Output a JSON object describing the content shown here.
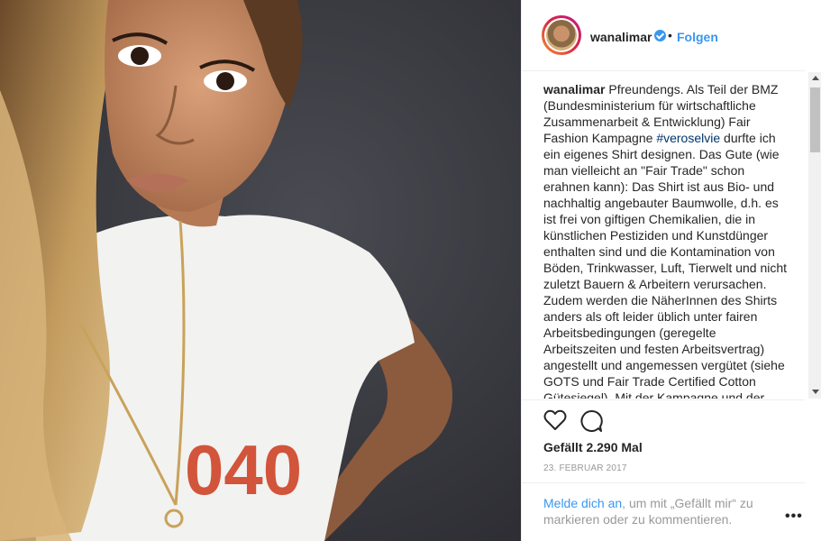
{
  "post": {
    "photo_print": "040"
  },
  "header": {
    "username": "wanalimar",
    "separator": "•",
    "follow_label": "Folgen"
  },
  "caption": {
    "username": "wanalimar",
    "text_before_tag": "Pfreundengs. Als Teil der BMZ (Bundesministerium für wirtschaftliche Zusammenarbeit & Entwicklung) Fair Fashion Kampagne",
    "hashtag": "#veroselvie",
    "text_after_tag": "durfte ich ein eigenes Shirt designen. Das Gute (wie man vielleicht an \"Fair Trade\" schon erahnen kann): Das Shirt ist aus Bio- und nachhaltig angebauter Baumwolle, d.h. es ist frei von giftigen Chemikalien, die in künstlichen Pestiziden und Kunstdünger enthalten sind und die Kontamination von Böden, Trinkwasser, Luft, Tierwelt und nicht zuletzt Bauern & Arbeitern verursachen. Zudem werden die NäherInnen des Shirts anders als oft leider üblich unter fairen Arbeitsbedingungen (geregelte Arbeitszeiten und festen Arbeitsvertrag) angestellt und angemessen vergütet (siehe GOTS und Fair Trade Certified Cotton Gütesiegel). Mit der Kampagne und der"
  },
  "stats": {
    "likes": "Gefällt 2.290 Mal",
    "date": "23. FEBRUAR 2017"
  },
  "login_prompt": {
    "link": "Melde dich an",
    "text": ", um mit „Gefällt mir“ zu markieren oder zu kommentieren."
  },
  "more_label": "•••",
  "colors": {
    "link_blue": "#3897f0",
    "hashtag": "#003569",
    "shirt_print": "#d2543a"
  }
}
